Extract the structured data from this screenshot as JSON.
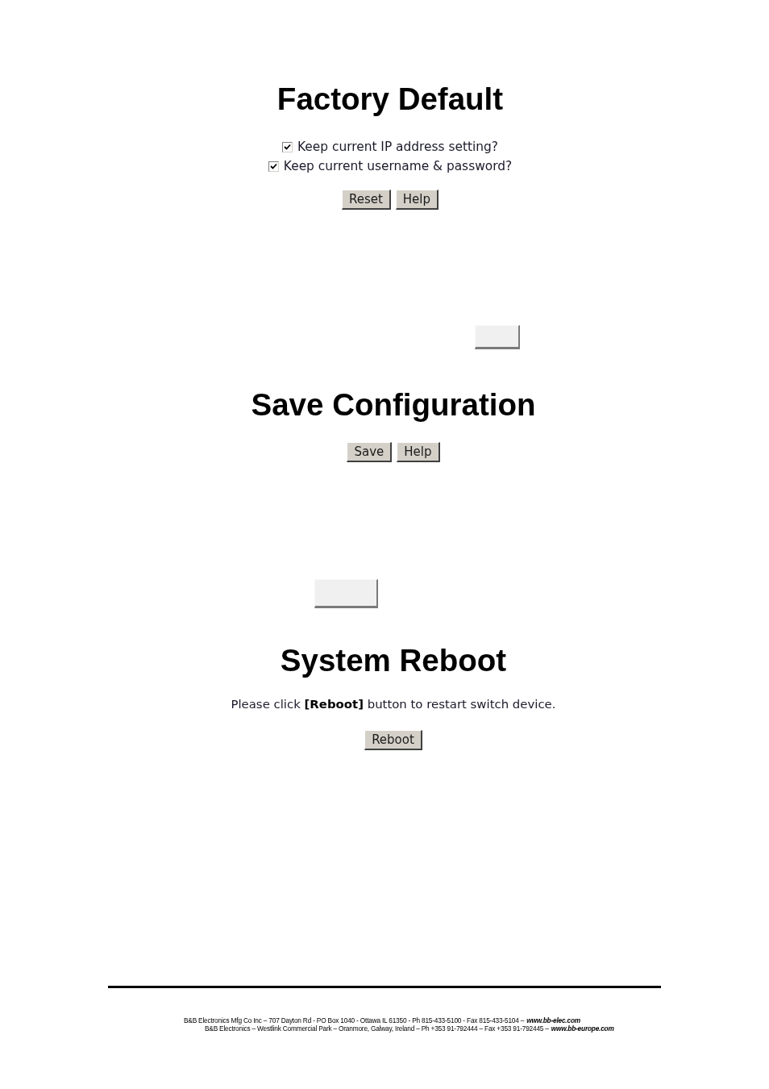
{
  "sections": [
    {
      "title": "Factory Default",
      "options": [
        {
          "label": "Keep current IP address setting?",
          "checked": true
        },
        {
          "label": "Keep current username & password?",
          "checked": true
        }
      ],
      "buttons": [
        "Reset",
        "Help"
      ]
    },
    {
      "title": "Save Configuration",
      "blank_button_before": true,
      "buttons": [
        "Save",
        "Help"
      ]
    },
    {
      "title": "System Reboot",
      "blank_button_before": true,
      "note": "Please click **[Reboot]** button to restart switch device.",
      "buttons": [
        "Reboot"
      ]
    }
  ],
  "footer": {
    "lines": [
      {
        "text": "B&B Electronics Mfg Co Inc – 707 Dayton Rd - PO Box 1040 - Ottawa IL 61350 - Ph 815-433-5100 - Fax 815-433-5104 –",
        "link": "www.bb-elec.com"
      },
      {
        "text": "B&B Electronics – Westlink Commercial Park – Oranmore, Galway, Ireland – Ph +353 91-792444 – Fax +353 91-792445 –",
        "link": "www.bb-europe.com"
      }
    ]
  }
}
